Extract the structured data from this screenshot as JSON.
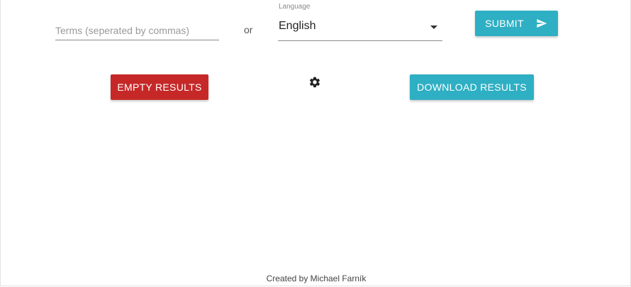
{
  "search": {
    "terms_placeholder": "Terms (seperated by commas)",
    "terms_value": "",
    "or_label": "or"
  },
  "language": {
    "label": "Language",
    "selected": "English"
  },
  "buttons": {
    "submit_label": "SUBMIT",
    "empty_label": "EMPTY RESULTS",
    "download_label": "DOWNLOAD RESULTS"
  },
  "icons": {
    "submit_icon": "send-icon",
    "settings_icon": "gear-icon",
    "language_caret": "caret-down-icon"
  },
  "colors": {
    "primary": "#2eafc3",
    "danger": "#c62828"
  },
  "footer": {
    "text": "Created by Michael Farník"
  }
}
